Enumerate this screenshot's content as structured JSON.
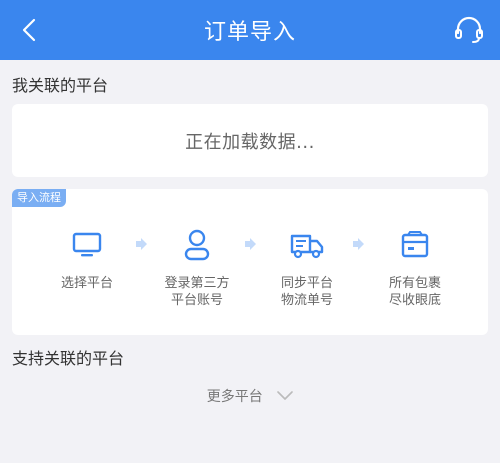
{
  "header": {
    "title": "订单导入",
    "back_icon": "back-arrow-icon",
    "service_icon": "headset-icon"
  },
  "linked": {
    "section_title": "我关联的平台",
    "loading_text": "正在加载数据..."
  },
  "flow": {
    "tag": "导入流程",
    "steps": [
      {
        "icon": "monitor-icon",
        "line1": "选择平台",
        "line2": ""
      },
      {
        "icon": "user-icon",
        "line1": "登录第三方",
        "line2": "平台账号"
      },
      {
        "icon": "truck-icon",
        "line1": "同步平台",
        "line2": "物流单号"
      },
      {
        "icon": "box-icon",
        "line1": "所有包裹",
        "line2": "尽收眼底"
      }
    ]
  },
  "supported": {
    "section_title": "支持关联的平台",
    "more_label": "更多平台"
  },
  "colors": {
    "primary": "#3a86ee",
    "background": "#f2f2f6"
  }
}
